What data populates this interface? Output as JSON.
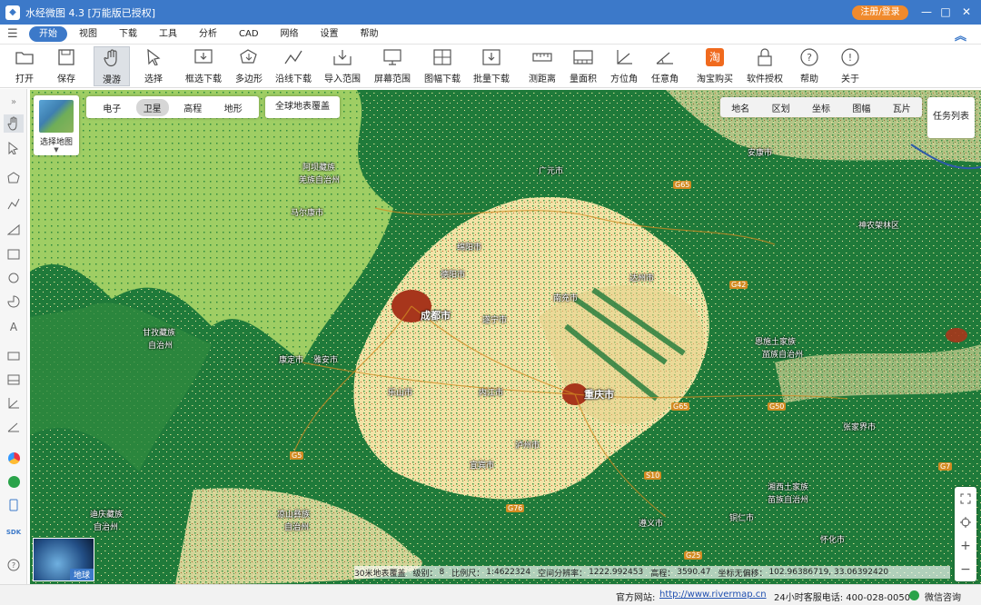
{
  "app": {
    "title": "水经微图 4.3 [万能版已授权]",
    "login_label": "注册/登录"
  },
  "menu": {
    "items": [
      "开始",
      "视图",
      "下载",
      "工具",
      "分析",
      "CAD",
      "网络",
      "设置",
      "帮助"
    ]
  },
  "toolbar": {
    "items": [
      "打开",
      "保存",
      "漫游",
      "选择",
      "框选下载",
      "多边形",
      "沿线下载",
      "导入范围",
      "屏幕范围",
      "图幅下载",
      "批量下载",
      "测距离",
      "量面积",
      "方位角",
      "任意角",
      "淘宝购买",
      "软件授权",
      "帮助",
      "关于"
    ]
  },
  "map": {
    "select_map_label": "选择地图",
    "types": [
      "电子",
      "卫星",
      "高程",
      "地形"
    ],
    "active_type": "卫星",
    "global_cover": "全球地表覆盖",
    "layers": [
      "地名",
      "区划",
      "坐标",
      "图幅",
      "瓦片"
    ],
    "task_list": "任务列表",
    "globe_label": "地球",
    "places": [
      {
        "name": "成都市",
        "big": true
      },
      {
        "name": "重庆市",
        "big": true
      },
      {
        "name": "马尔康市",
        "big": false
      },
      {
        "name": "甘孜藏族",
        "big": false
      },
      {
        "name": "自治州",
        "big": false
      },
      {
        "name": "康定市",
        "big": false
      },
      {
        "name": "雅安市",
        "big": false
      },
      {
        "name": "安康市",
        "big": false
      },
      {
        "name": "神农架林区",
        "big": false
      },
      {
        "name": "张家界市",
        "big": false
      },
      {
        "name": "迪庆藏族",
        "big": false
      },
      {
        "name": "自治州",
        "big": false
      },
      {
        "name": "阿坝藏族",
        "big": false
      },
      {
        "name": "羌族自治州",
        "big": false
      },
      {
        "name": "广元市",
        "big": false
      },
      {
        "name": "绵阳市",
        "big": false
      },
      {
        "name": "德阳市",
        "big": false
      },
      {
        "name": "遂宁市",
        "big": false
      },
      {
        "name": "南充市",
        "big": false
      },
      {
        "name": "达州市",
        "big": false
      },
      {
        "name": "乐山市",
        "big": false
      },
      {
        "name": "内江市",
        "big": false
      },
      {
        "name": "宜宾市",
        "big": false
      },
      {
        "name": "泸州市",
        "big": false
      },
      {
        "name": "恩施土家族",
        "big": false
      },
      {
        "name": "苗族自治州",
        "big": false
      },
      {
        "name": "湘西土家族",
        "big": false
      },
      {
        "name": "苗族自治州",
        "big": false
      },
      {
        "name": "遵义市",
        "big": false
      },
      {
        "name": "铜仁市",
        "big": false
      },
      {
        "name": "怀化市",
        "big": false
      },
      {
        "name": "凉山彝族",
        "big": false
      },
      {
        "name": "自治州",
        "big": false
      }
    ],
    "roads": [
      "G65",
      "G42",
      "G65",
      "G5",
      "G50",
      "G76",
      "S10",
      "G25",
      "G7"
    ],
    "status": {
      "layer": "30米地表覆盖",
      "level_label": "级别：",
      "level": "8",
      "scale_label": "比例尺：",
      "scale": "1:4622324",
      "resolution_label": "空间分辨率：",
      "resolution": "1222.992453",
      "elevation_label": "高程：",
      "elevation": "3590.47",
      "crs_label": "坐标无偏移：",
      "coords": "102.96386719, 33.06392420"
    }
  },
  "footer": {
    "site_label": "官方网站:",
    "site_url": "http://www.rivermap.cn",
    "hotline": "24小时客服电话: 400-028-0050",
    "wechat": "微信咨询"
  },
  "colors": {
    "accent": "#3c79c9",
    "login": "#f08a2c",
    "forest": "#1f7a3a",
    "grassland": "#9fce64",
    "cropland": "#f2e3a6",
    "urban": "#a7361c"
  }
}
